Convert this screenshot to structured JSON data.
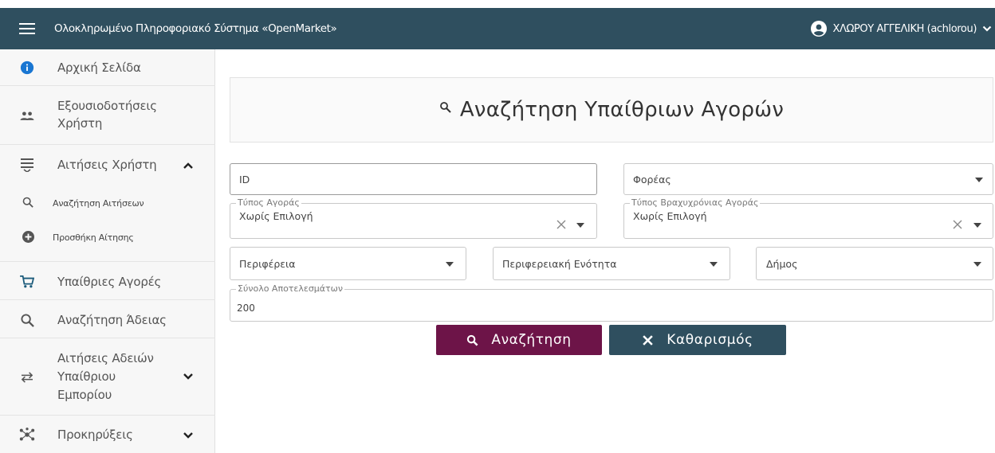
{
  "topbar": {
    "menu_icon": "hamburger-menu-icon",
    "app_title": "Ολοκληρωμένο Πληροφοριακό Σύστημα «OpenMarket»",
    "user_name": "ΧΛΩΡΟΥ ΑΓΓΕΛΙΚΗ (achlorou)",
    "user_icon": "account-circle-icon"
  },
  "sidebar": {
    "items": [
      {
        "label": "Αρχική Σελίδα",
        "icon": "info-icon"
      },
      {
        "label": "Εξουσιοδοτήσεις",
        "label2": "Χρήστη",
        "icon": "people-icon"
      },
      {
        "label": "Αιτήσεις Χρήστη",
        "icon": "list-icon",
        "expanded": true
      },
      {
        "label": "Αναζήτηση Αιτήσεων",
        "icon": "search-icon"
      },
      {
        "label": "Προσθήκη Αίτησης",
        "icon": "add-circle-icon"
      },
      {
        "label": "Υπαίθριες Αγορές",
        "icon": "cart-icon"
      },
      {
        "label": "Αναζήτηση Άδειας",
        "icon": "search-icon"
      },
      {
        "label": "Αιτήσεις Αδειών",
        "label2": "Υπαίθριου",
        "label3": "Εμπορίου",
        "icon": "swap-icon",
        "expanded": false
      },
      {
        "label": "Προκηρύξεις",
        "icon": "network-icon",
        "expanded": false
      }
    ]
  },
  "main": {
    "title": "Αναζήτηση Υπαίθριων Αγορών",
    "fields": {
      "id_placeholder": "ID",
      "foreas_placeholder": "Φορέας",
      "market_type_legend": "Τύπος Αγοράς",
      "market_type_value": "Χωρίς Επιλογή",
      "short_market_type_legend": "Τύπος Βραχυχρόνιας Αγοράς",
      "short_market_type_value": "Χωρίς Επιλογή",
      "region_placeholder": "Περιφέρεια",
      "regional_unit_placeholder": "Περιφερειακή Ενότητα",
      "municipality_placeholder": "Δήμος",
      "results_legend": "Σύνολο Αποτελεσμάτων",
      "results_value": "200"
    },
    "buttons": {
      "search_label": "Αναζήτηση",
      "clear_label": "Καθαρισμός"
    },
    "colors": {
      "topbar": "#2f4f5f",
      "search_button": "#6d1448",
      "clear_button": "#2f4f5f",
      "info_icon": "#1976d2"
    }
  }
}
